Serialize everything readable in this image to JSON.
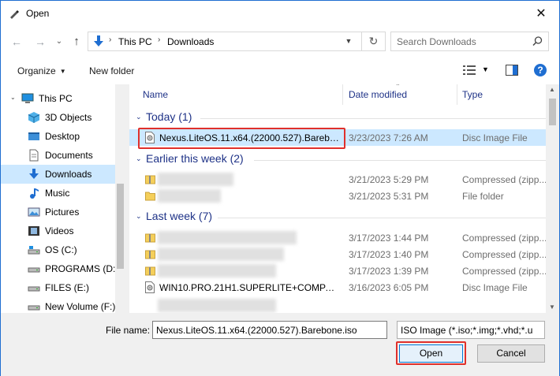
{
  "window": {
    "title": "Open",
    "close_glyph": "✕"
  },
  "nav": {
    "back_glyph": "←",
    "forward_glyph": "→",
    "recent_glyph": "⌄",
    "up_glyph": "↑",
    "breadcrumbs": [
      "This PC",
      "Downloads"
    ],
    "crumb_sep": "›",
    "refresh_glyph": "↻",
    "search_placeholder": "Search Downloads"
  },
  "toolbar": {
    "organize_label": "Organize",
    "new_folder_label": "New folder",
    "help_label": "?"
  },
  "sidebar": {
    "items": [
      {
        "label": "This PC",
        "icon": "pc-icon"
      },
      {
        "label": "3D Objects",
        "icon": "cube-icon"
      },
      {
        "label": "Desktop",
        "icon": "desktop-icon"
      },
      {
        "label": "Documents",
        "icon": "document-icon"
      },
      {
        "label": "Downloads",
        "icon": "download-icon"
      },
      {
        "label": "Music",
        "icon": "music-icon"
      },
      {
        "label": "Pictures",
        "icon": "pictures-icon"
      },
      {
        "label": "Videos",
        "icon": "video-icon"
      },
      {
        "label": "OS (C:)",
        "icon": "drive-icon"
      },
      {
        "label": "PROGRAMS (D:)",
        "icon": "drive-icon"
      },
      {
        "label": "FILES (E:)",
        "icon": "drive-icon"
      },
      {
        "label": "New Volume (F:)",
        "icon": "drive-icon"
      }
    ],
    "selected_index": 4
  },
  "columns": {
    "name": "Name",
    "date": "Date modified",
    "type": "Type"
  },
  "groups": [
    {
      "label": "Today (1)",
      "rows": [
        {
          "name": "Nexus.LiteOS.11.x64.(22000.527).Barebone.iso",
          "date": "3/23/2023 7:26 AM",
          "type": "Disc Image File",
          "icon": "disc-image-icon",
          "selected": true
        }
      ]
    },
    {
      "label": "Earlier this week (2)",
      "rows": [
        {
          "name": "",
          "date": "3/21/2023 5:29 PM",
          "type": "Compressed (zipp...",
          "icon": "zip-folder-icon"
        },
        {
          "name": "",
          "date": "3/21/2023 5:31 PM",
          "type": "File folder",
          "icon": "folder-icon"
        }
      ]
    },
    {
      "label": "Last week (7)",
      "rows": [
        {
          "name": "",
          "date": "3/17/2023 1:44 PM",
          "type": "Compressed (zipp...",
          "icon": "zip-folder-icon"
        },
        {
          "name": "",
          "date": "3/17/2023 1:40 PM",
          "type": "Compressed (zipp...",
          "icon": "zip-folder-icon"
        },
        {
          "name": "",
          "date": "3/17/2023 1:39 PM",
          "type": "Compressed (zipp...",
          "icon": "zip-folder-icon"
        },
        {
          "name": "WIN10.PRO.21H1.SUPERLITE+COMPACT....",
          "date": "3/16/2023 6:05 PM",
          "type": "Disc Image File",
          "icon": "disc-image-icon"
        }
      ]
    }
  ],
  "bottom": {
    "file_name_label": "File name:",
    "file_name_value": "Nexus.LiteOS.11.x64.(22000.527).Barebone.iso",
    "file_type_value": "ISO Image (*.iso;*.img;*.vhd;*.u",
    "open_label": "Open",
    "cancel_label": "Cancel"
  },
  "colors": {
    "accent": "#1f6ed1",
    "selection": "#cce8ff",
    "highlight": "#e0302b",
    "group_text": "#1e3287"
  }
}
